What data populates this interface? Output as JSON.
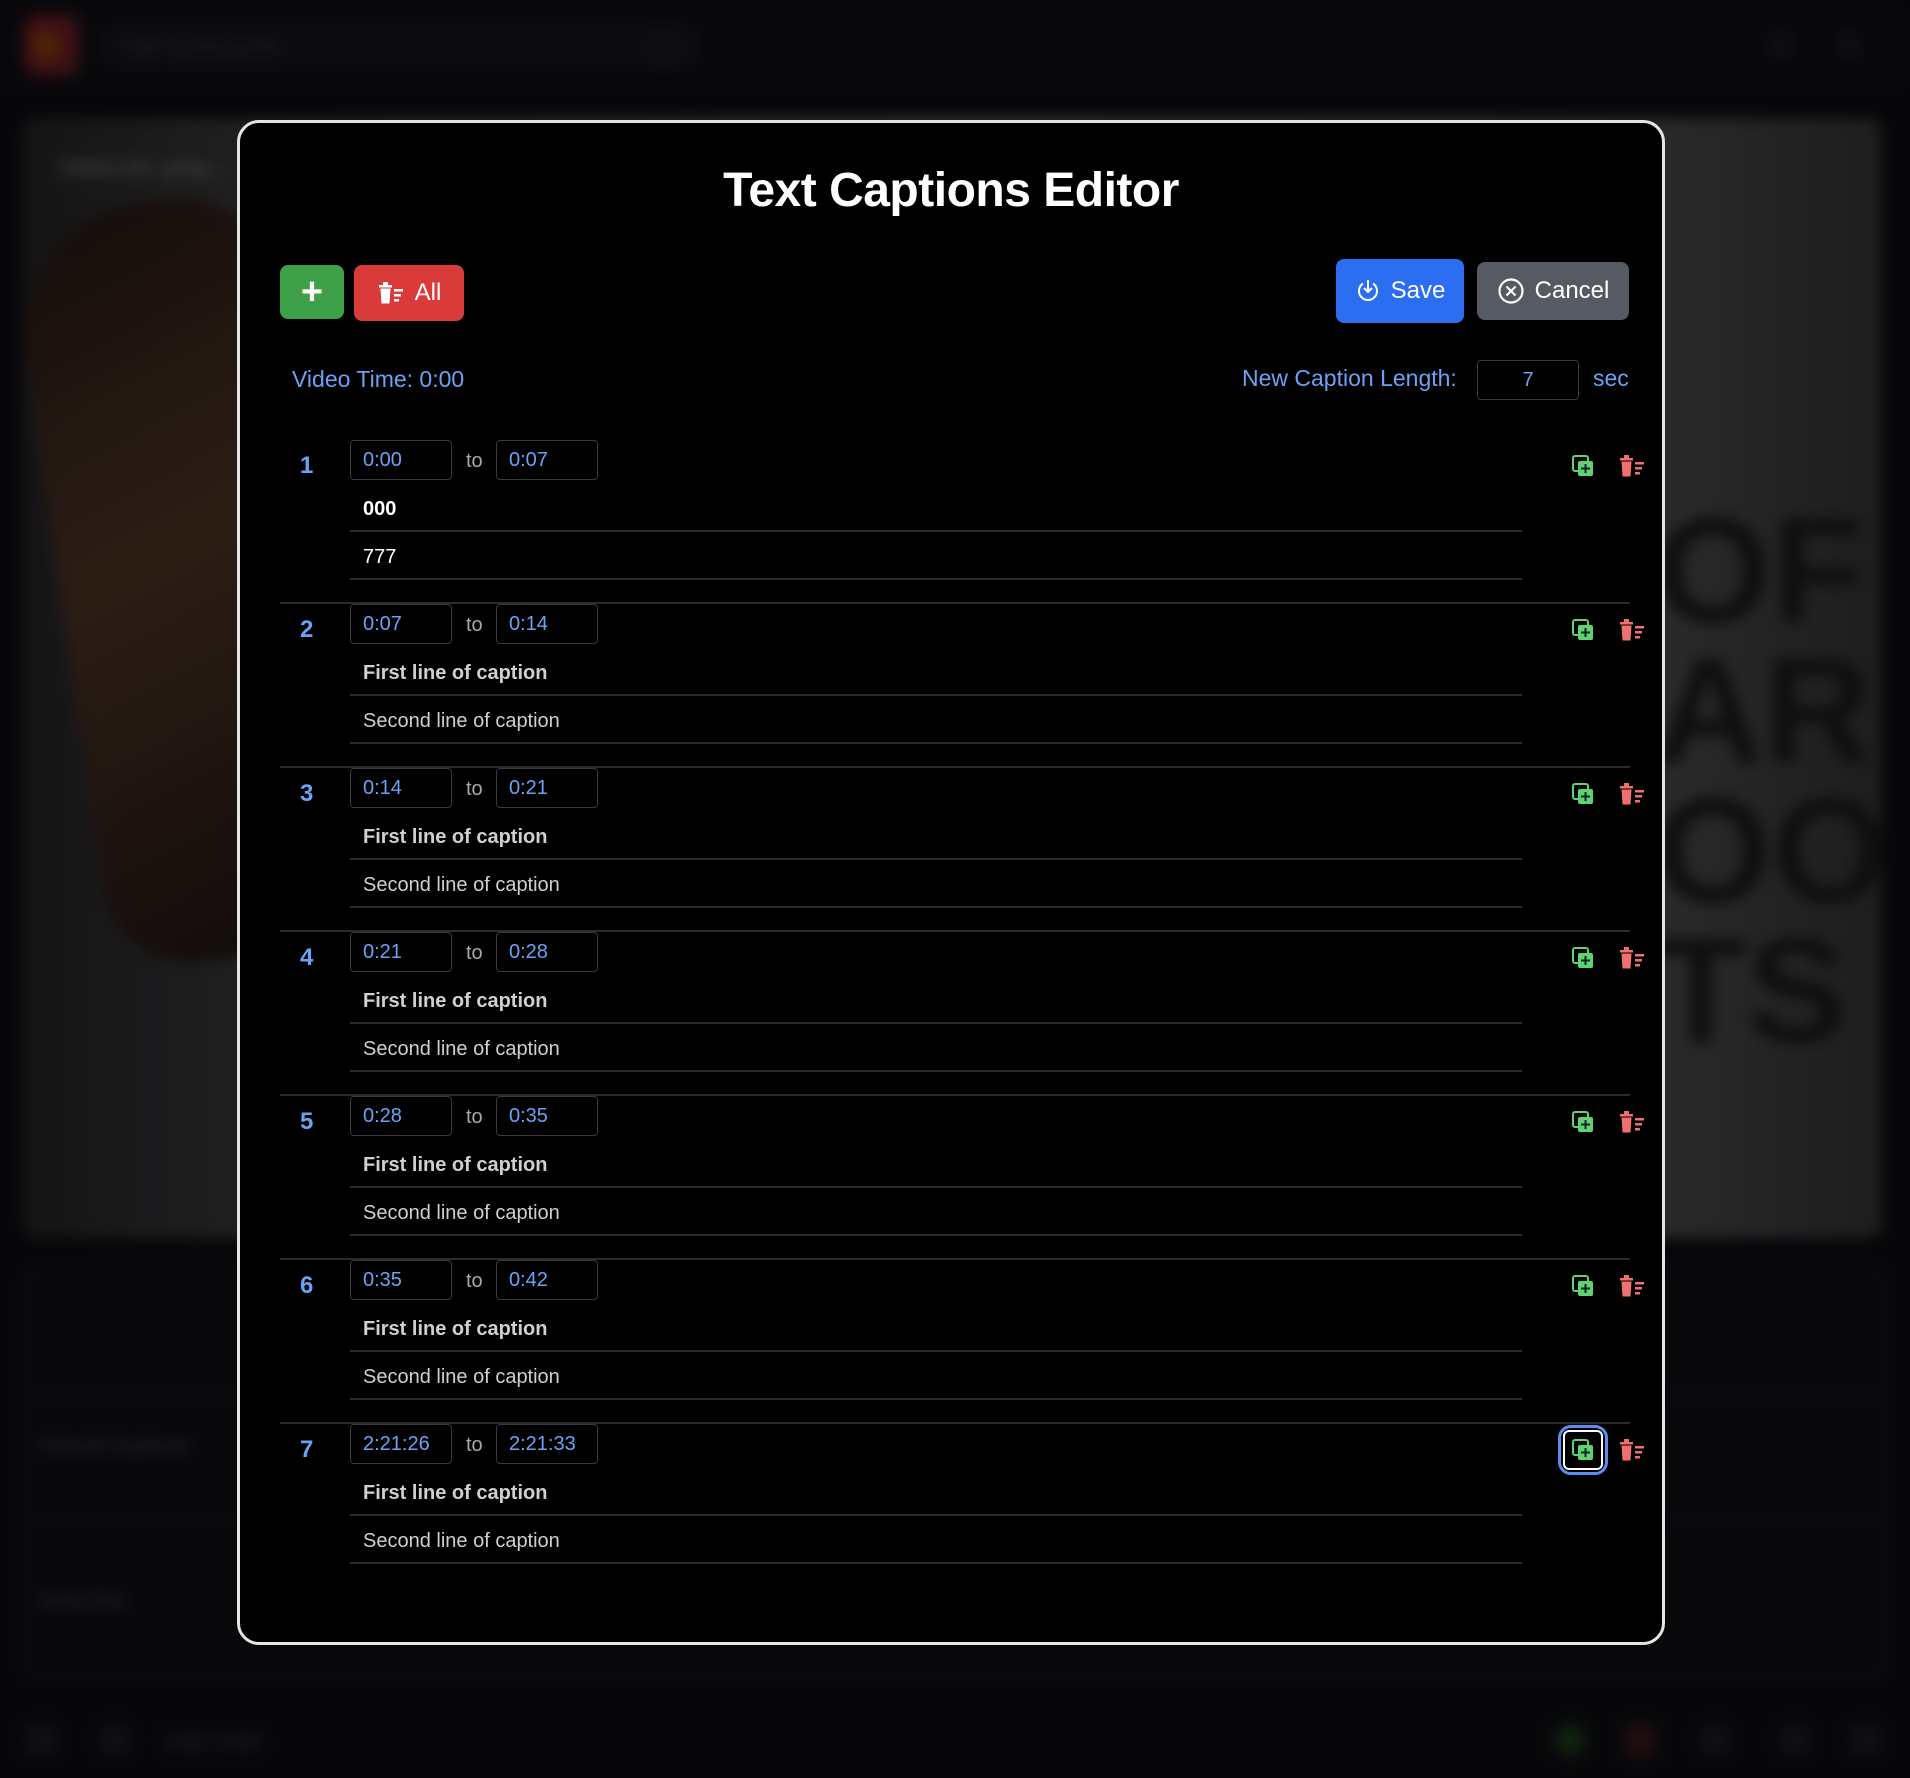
{
  "background": {
    "search_placeholder": "Type to play guitar",
    "video_title": "Video 01: pixa...",
    "overlay_text": "OF\nAR\nOO\nTS",
    "list_rows": [
      "Chords Captions",
      "Auto-Gen"
    ],
    "playback_time": "0:00 / 0:00"
  },
  "modal": {
    "title": "Text Captions Editor",
    "toolbar": {
      "add_icon": "plus-icon",
      "delete_all_label": "All",
      "delete_all_icon": "trash-icon",
      "save_label": "Save",
      "save_icon": "save-download-icon",
      "cancel_label": "Cancel",
      "cancel_icon": "cancel-circle-x-icon"
    },
    "video_time_label": "Video Time: 0:00",
    "new_caption_length": {
      "label": "New Caption Length:",
      "value": "7",
      "unit": "sec"
    },
    "separator_word": "to",
    "captions": [
      {
        "num": "1",
        "start": "0:00",
        "end": "0:07",
        "line1": "000",
        "line2": "777"
      },
      {
        "num": "2",
        "start": "0:07",
        "end": "0:14",
        "line1": "First line of caption",
        "line2": "Second line of caption"
      },
      {
        "num": "3",
        "start": "0:14",
        "end": "0:21",
        "line1": "First line of caption",
        "line2": "Second line of caption"
      },
      {
        "num": "4",
        "start": "0:21",
        "end": "0:28",
        "line1": "First line of caption",
        "line2": "Second line of caption"
      },
      {
        "num": "5",
        "start": "0:28",
        "end": "0:35",
        "line1": "First line of caption",
        "line2": "Second line of caption"
      },
      {
        "num": "6",
        "start": "0:35",
        "end": "0:42",
        "line1": "First line of caption",
        "line2": "Second line of caption"
      },
      {
        "num": "7",
        "start": "2:21:26",
        "end": "2:21:33",
        "line1": "First line of caption",
        "line2": "Second line of caption"
      }
    ],
    "colors": {
      "accent_blue": "#6aa3f5",
      "add_green": "#3fa04a",
      "delete_red": "#d93a3a",
      "save_blue": "#2c6ef2",
      "cancel_gray": "#555a63",
      "icon_green": "#5fd36e",
      "icon_red": "#f07070"
    }
  }
}
